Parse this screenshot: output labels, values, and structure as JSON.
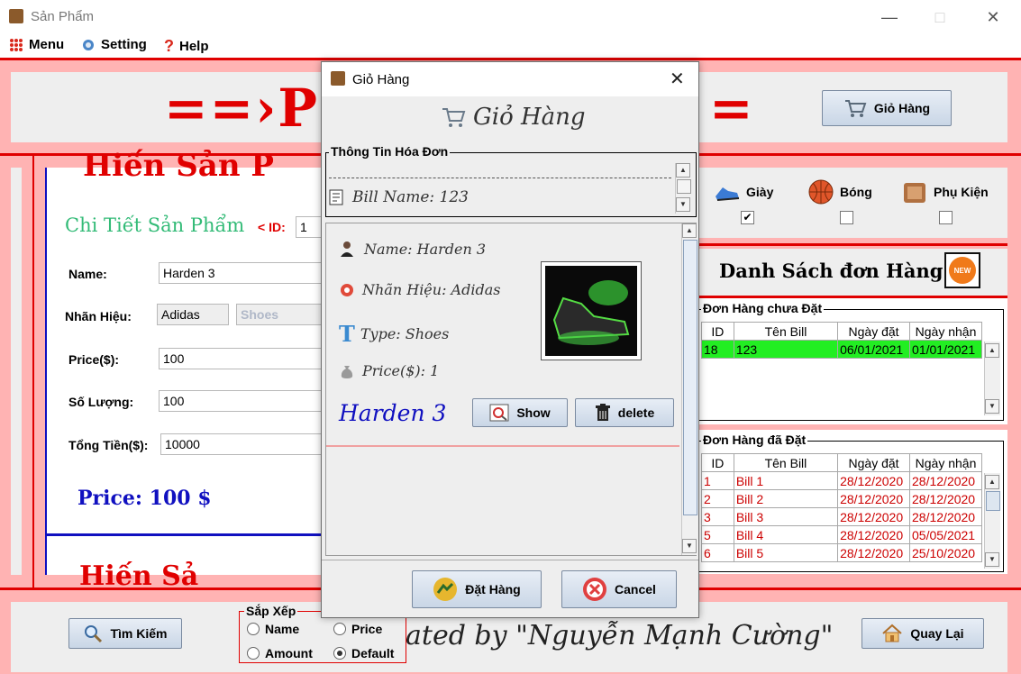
{
  "window": {
    "title": "Sản Phẩm"
  },
  "menubar": {
    "menu": "Menu",
    "setting": "Setting",
    "help": "Help"
  },
  "header": {
    "banner_left": "==›PI",
    "banner_right": "=",
    "cart_button": "Giỏ Hàng"
  },
  "detail": {
    "heading_clip": "Hiến Sản P",
    "title": "Chi Tiết Sản Phẩm",
    "id_label": "< ID:",
    "id_value": "1",
    "name_label": "Name:",
    "name_value": "Harden 3",
    "brand_label": "Nhãn Hiệu:",
    "brand_value": "Adidas",
    "type_value": "Shoes",
    "price_label": "Price($):",
    "price_value": "100",
    "qty_label": "Số Lượng:",
    "qty_value": "100",
    "total_label": "Tổng Tiền($):",
    "total_value": "10000",
    "price_big": "Price: 100 $",
    "bottom_clip": "Hiến Sả"
  },
  "categories": [
    {
      "label": "Giày",
      "checked": true,
      "mark": "✔"
    },
    {
      "label": "Bóng",
      "checked": false,
      "mark": ""
    },
    {
      "label": "Phụ Kiện",
      "checked": false,
      "mark": ""
    }
  ],
  "orders": {
    "title": "Danh Sách đơn Hàng",
    "new_badge": "NEW",
    "pending": {
      "legend": "Đơn Hàng chưa Đặt",
      "columns": [
        "ID",
        "Tên Bill",
        "Ngày đặt",
        "Ngày nhận"
      ],
      "rows": [
        [
          "18",
          "123",
          "06/01/2021",
          "01/01/2021"
        ]
      ]
    },
    "placed": {
      "legend": "Đơn Hàng đã Đặt",
      "columns": [
        "ID",
        "Tên Bill",
        "Ngày đặt",
        "Ngày nhận"
      ],
      "rows": [
        [
          "1",
          "Bill 1",
          "28/12/2020",
          "28/12/2020"
        ],
        [
          "2",
          "Bill 2",
          "28/12/2020",
          "28/12/2020"
        ],
        [
          "3",
          "Bill 3",
          "28/12/2020",
          "28/12/2020"
        ],
        [
          "5",
          "Bill 4",
          "28/12/2020",
          "05/05/2021"
        ],
        [
          "6",
          "Bill 5",
          "28/12/2020",
          "25/10/2020"
        ]
      ]
    }
  },
  "footer": {
    "search_button": "Tìm Kiếm",
    "sort_legend": "Sắp Xếp",
    "sort_options": [
      {
        "label": "Name",
        "selected": false
      },
      {
        "label": "Price",
        "selected": false
      },
      {
        "label": "Amount",
        "selected": false
      },
      {
        "label": "Default",
        "selected": true
      }
    ],
    "credit": "ated by \"Nguyễn Mạnh Cường\"",
    "back_button": "Quay Lại"
  },
  "dialog": {
    "title": "Giỏ Hàng",
    "heading": "Giỏ Hàng",
    "bill_section": "Thông Tin Hóa Đơn",
    "bill_name": "Bill Name: 123",
    "item": {
      "name": "Name: Harden 3",
      "brand": "Nhãn Hiệu: Adidas",
      "type": "Type: Shoes",
      "price": "Price($): 1",
      "big_name": "Harden 3",
      "show_button": "Show",
      "delete_button": "delete"
    },
    "order_button": "Đặt Hàng",
    "cancel_button": "Cancel"
  }
}
